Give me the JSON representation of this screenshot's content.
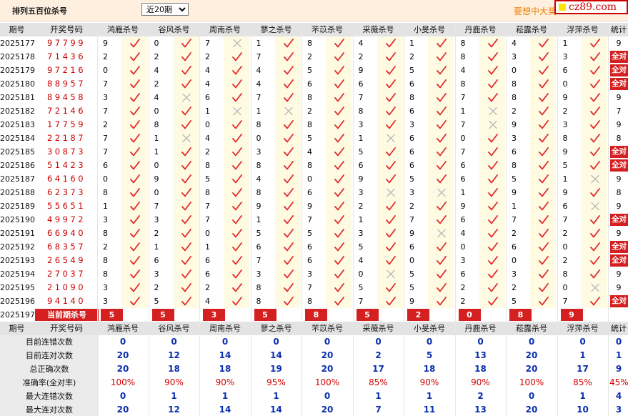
{
  "header": {
    "title": "排列五百位杀号",
    "select_value": "近20期",
    "promo": "要想中大奖",
    "logo": "cz89.com"
  },
  "columns": {
    "period": "期号",
    "lottery": "开奖号码",
    "experts": [
      "鸿雁杀号",
      "谷风杀号",
      "周南杀号",
      "蓼之杀号",
      "芣苡杀号",
      "采薇杀号",
      "小旻杀号",
      "丹鹿杀号",
      "菘露杀号",
      "浮萍杀号"
    ],
    "stat": "统计"
  },
  "rows": [
    {
      "period": "2025177",
      "lottery": "97799",
      "kills": [
        9,
        0,
        7,
        1,
        8,
        4,
        1,
        8,
        4,
        1
      ],
      "ok": [
        1,
        1,
        0,
        1,
        1,
        1,
        1,
        1,
        1,
        1
      ],
      "stat": "9"
    },
    {
      "period": "2025178",
      "lottery": "71436",
      "kills": [
        2,
        2,
        2,
        7,
        2,
        2,
        2,
        8,
        3,
        3
      ],
      "ok": [
        1,
        1,
        1,
        1,
        1,
        1,
        1,
        1,
        1,
        1
      ],
      "stat": "全对"
    },
    {
      "period": "2025179",
      "lottery": "97216",
      "kills": [
        0,
        4,
        4,
        4,
        5,
        9,
        5,
        4,
        0,
        6
      ],
      "ok": [
        1,
        1,
        1,
        1,
        1,
        1,
        1,
        1,
        1,
        1
      ],
      "stat": "全对"
    },
    {
      "period": "2025180",
      "lottery": "88957",
      "kills": [
        7,
        2,
        4,
        4,
        6,
        6,
        6,
        8,
        8,
        0
      ],
      "ok": [
        1,
        1,
        1,
        1,
        1,
        1,
        1,
        1,
        1,
        1
      ],
      "stat": "全对"
    },
    {
      "period": "2025181",
      "lottery": "89458",
      "kills": [
        3,
        4,
        6,
        7,
        8,
        7,
        8,
        7,
        8,
        9
      ],
      "ok": [
        1,
        0,
        1,
        1,
        1,
        1,
        1,
        1,
        1,
        1
      ],
      "stat": "9"
    },
    {
      "period": "2025182",
      "lottery": "72146",
      "kills": [
        7,
        0,
        1,
        1,
        2,
        8,
        6,
        1,
        2,
        2
      ],
      "ok": [
        1,
        1,
        0,
        0,
        1,
        1,
        1,
        0,
        1,
        1
      ],
      "stat": "7"
    },
    {
      "period": "2025183",
      "lottery": "17759",
      "kills": [
        2,
        8,
        0,
        8,
        8,
        3,
        3,
        7,
        9,
        3
      ],
      "ok": [
        1,
        1,
        1,
        1,
        1,
        1,
        1,
        0,
        1,
        1
      ],
      "stat": "9"
    },
    {
      "period": "2025184",
      "lottery": "22187",
      "kills": [
        7,
        1,
        4,
        0,
        5,
        1,
        6,
        0,
        3,
        8
      ],
      "ok": [
        1,
        0,
        1,
        1,
        1,
        0,
        1,
        1,
        1,
        1
      ],
      "stat": "8"
    },
    {
      "period": "2025185",
      "lottery": "30873",
      "kills": [
        7,
        1,
        2,
        3,
        4,
        5,
        6,
        7,
        6,
        9
      ],
      "ok": [
        1,
        1,
        1,
        1,
        1,
        1,
        1,
        1,
        1,
        1
      ],
      "stat": "全对"
    },
    {
      "period": "2025186",
      "lottery": "51423",
      "kills": [
        6,
        0,
        8,
        8,
        8,
        6,
        6,
        6,
        8,
        5
      ],
      "ok": [
        1,
        1,
        1,
        1,
        1,
        1,
        1,
        1,
        1,
        1
      ],
      "stat": "全对"
    },
    {
      "period": "2025187",
      "lottery": "64160",
      "kills": [
        0,
        9,
        5,
        4,
        0,
        9,
        5,
        6,
        5,
        1
      ],
      "ok": [
        1,
        1,
        1,
        1,
        1,
        1,
        1,
        1,
        1,
        0
      ],
      "stat": "9"
    },
    {
      "period": "2025188",
      "lottery": "62373",
      "kills": [
        8,
        0,
        8,
        8,
        6,
        3,
        3,
        1,
        9,
        9
      ],
      "ok": [
        1,
        1,
        1,
        1,
        1,
        0,
        0,
        1,
        1,
        1
      ],
      "stat": "8"
    },
    {
      "period": "2025189",
      "lottery": "55651",
      "kills": [
        1,
        7,
        7,
        9,
        9,
        2,
        2,
        9,
        1,
        6
      ],
      "ok": [
        1,
        1,
        1,
        1,
        1,
        1,
        1,
        1,
        1,
        0
      ],
      "stat": "9"
    },
    {
      "period": "2025190",
      "lottery": "49972",
      "kills": [
        3,
        3,
        7,
        1,
        7,
        1,
        7,
        6,
        7,
        7
      ],
      "ok": [
        1,
        1,
        1,
        1,
        1,
        1,
        1,
        1,
        1,
        1
      ],
      "stat": "全对"
    },
    {
      "period": "2025191",
      "lottery": "66940",
      "kills": [
        8,
        2,
        0,
        5,
        5,
        3,
        9,
        4,
        2,
        2
      ],
      "ok": [
        1,
        1,
        1,
        1,
        1,
        1,
        0,
        1,
        1,
        1
      ],
      "stat": "9"
    },
    {
      "period": "2025192",
      "lottery": "68357",
      "kills": [
        2,
        1,
        1,
        6,
        6,
        5,
        6,
        0,
        6,
        0
      ],
      "ok": [
        1,
        1,
        1,
        1,
        1,
        1,
        1,
        1,
        1,
        1
      ],
      "stat": "全对"
    },
    {
      "period": "2025193",
      "lottery": "26549",
      "kills": [
        8,
        6,
        6,
        7,
        6,
        4,
        0,
        3,
        0,
        2
      ],
      "ok": [
        1,
        1,
        1,
        1,
        1,
        1,
        1,
        1,
        1,
        1
      ],
      "stat": "全对"
    },
    {
      "period": "2025194",
      "lottery": "27037",
      "kills": [
        8,
        3,
        6,
        3,
        3,
        0,
        5,
        6,
        3,
        8
      ],
      "ok": [
        1,
        1,
        1,
        1,
        1,
        0,
        1,
        1,
        1,
        1
      ],
      "stat": "9"
    },
    {
      "period": "2025195",
      "lottery": "21090",
      "kills": [
        3,
        2,
        2,
        8,
        7,
        5,
        5,
        2,
        2,
        0
      ],
      "ok": [
        1,
        1,
        1,
        1,
        1,
        1,
        1,
        1,
        1,
        0
      ],
      "stat": "9"
    },
    {
      "period": "2025196",
      "lottery": "94140",
      "kills": [
        3,
        5,
        4,
        8,
        8,
        7,
        9,
        2,
        5,
        7
      ],
      "ok": [
        1,
        1,
        1,
        1,
        1,
        1,
        1,
        1,
        1,
        1
      ],
      "stat": "全对"
    }
  ],
  "current": {
    "period": "2025197",
    "label": "当前期杀号",
    "kills": [
      5,
      5,
      3,
      5,
      8,
      5,
      2,
      0,
      8,
      9
    ]
  },
  "stats": [
    {
      "label": "目前连错次数",
      "values": [
        "0",
        "0",
        "0",
        "0",
        "0",
        "0",
        "0",
        "0",
        "0",
        "0"
      ],
      "stat": "0",
      "pct": false
    },
    {
      "label": "目前连对次数",
      "values": [
        "20",
        "12",
        "14",
        "14",
        "20",
        "2",
        "5",
        "13",
        "20",
        "1"
      ],
      "stat": "1",
      "pct": false
    },
    {
      "label": "总正确次数",
      "values": [
        "20",
        "18",
        "18",
        "19",
        "20",
        "17",
        "18",
        "18",
        "20",
        "17"
      ],
      "stat": "9",
      "pct": false
    },
    {
      "label": "准确率(全对率)",
      "values": [
        "100%",
        "90%",
        "90%",
        "95%",
        "100%",
        "85%",
        "90%",
        "90%",
        "100%",
        "85%"
      ],
      "stat": "45%",
      "pct": true
    },
    {
      "label": "最大连错次数",
      "values": [
        "0",
        "1",
        "1",
        "1",
        "0",
        "1",
        "1",
        "2",
        "0",
        "1"
      ],
      "stat": "4",
      "pct": false
    },
    {
      "label": "最大连对次数",
      "values": [
        "20",
        "12",
        "14",
        "14",
        "20",
        "7",
        "11",
        "13",
        "20",
        "10"
      ],
      "stat": "3",
      "pct": false
    }
  ],
  "colors": {
    "accent_red": "#d42020",
    "check": "#e02a2a",
    "cross": "#b9b9b9",
    "stat_blue": "#0a2fae",
    "header_bg": "#ffefdf"
  }
}
